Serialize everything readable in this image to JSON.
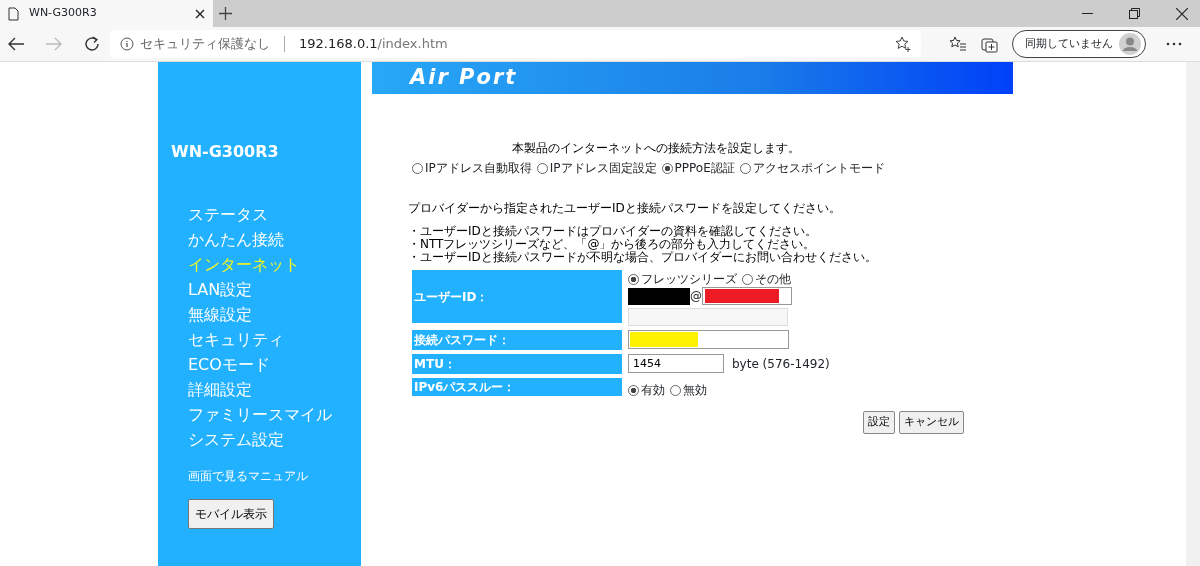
{
  "browser": {
    "tab_title": "WN-G300R3",
    "security": "セキュリティ保護なし",
    "url_host": "192.168.0.1",
    "url_path": "/index.htm",
    "sync": "同期していません"
  },
  "sidebar": {
    "model": "WN-G300R3",
    "items": [
      {
        "label": "ステータス",
        "selected": false
      },
      {
        "label": "かんたん接続",
        "selected": false
      },
      {
        "label": "インターネット",
        "selected": true
      },
      {
        "label": "LAN設定",
        "selected": false
      },
      {
        "label": "無線設定",
        "selected": false
      },
      {
        "label": "セキュリティ",
        "selected": false
      },
      {
        "label": "ECOモード",
        "selected": false
      },
      {
        "label": "詳細設定",
        "selected": false
      },
      {
        "label": "ファミリースマイル",
        "selected": false
      },
      {
        "label": "システム設定",
        "selected": false
      }
    ],
    "manual_link": "画面で見るマニュアル",
    "mobile_button": "モバイル表示"
  },
  "banner": {
    "logo": "Air Port"
  },
  "content": {
    "intro": "本製品のインターネットへの接続方法を設定します。",
    "modes": [
      {
        "label": "IPアドレス自動取得",
        "selected": false
      },
      {
        "label": "IPアドレス固定設定",
        "selected": false
      },
      {
        "label": "PPPoE認証",
        "selected": true
      },
      {
        "label": "アクセスポイントモード",
        "selected": false
      }
    ],
    "instruction": "プロバイダーから指定されたユーザーIDと接続パスワードを設定してください。",
    "notes": [
      "・ユーザーIDと接続パスワードはプロバイダーの資料を確認してください。",
      "・NTTフレッツシリーズなど、「@」から後ろの部分も入力してください。",
      "・ユーザーIDと接続パスワードが不明な場合、プロバイダーにお問い合わせください。"
    ],
    "form": [
      {
        "kind": "userid",
        "label": "ユーザーID：",
        "options": [
          {
            "label": "フレッツシリーズ",
            "selected": true
          },
          {
            "label": "その他",
            "selected": false
          }
        ],
        "at": "@"
      },
      {
        "kind": "password",
        "label": "接続パスワード："
      },
      {
        "kind": "mtu",
        "label": "MTU：",
        "value": "1454",
        "hint": "byte (576-1492)"
      },
      {
        "kind": "ipv6",
        "label": "IPv6パススルー：",
        "options": [
          {
            "label": "有効",
            "selected": true
          },
          {
            "label": "無効",
            "selected": false
          }
        ]
      }
    ],
    "redaction_marks": [
      {
        "color": "#000000"
      },
      {
        "color": "#ed1c24"
      },
      {
        "color": "#fff200"
      }
    ],
    "buttons": [
      "設定",
      "キャンセル"
    ]
  }
}
